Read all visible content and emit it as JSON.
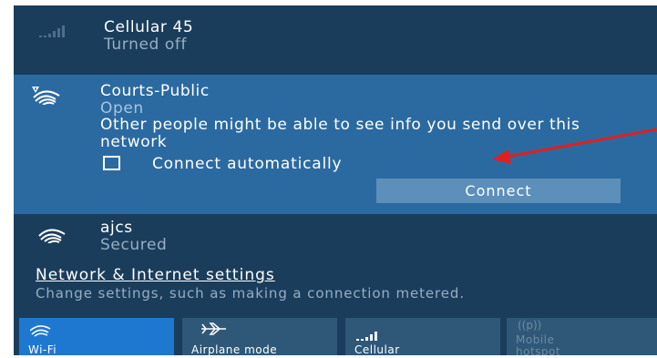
{
  "networks": {
    "cellular": {
      "name": "Cellular 45",
      "status": "Turned off"
    },
    "selected": {
      "name": "Courts-Public",
      "status": "Open",
      "warning": "Other people might be able to see info you send over this network",
      "auto_label": "Connect automatically",
      "auto_checked": false,
      "connect_label": "Connect"
    },
    "ajcs": {
      "name": "ajcs",
      "status": "Secured"
    }
  },
  "settings": {
    "link": "Network & Internet settings",
    "description": "Change settings, such as making a connection metered."
  },
  "tiles": [
    {
      "label": "Wi-Fi",
      "icon": "wifi-icon",
      "active": true
    },
    {
      "label": "Airplane mode",
      "icon": "airplane-icon",
      "active": false
    },
    {
      "label": "Cellular",
      "icon": "cellular-icon",
      "active": false
    },
    {
      "label": "Mobile hotspot",
      "icon": "hotspot-icon",
      "active": false,
      "disabled": true
    }
  ],
  "colors": {
    "panel": "#1a3d5c",
    "selected": "#2b6aa1",
    "accent": "#1f78cf",
    "arrow": "#e02020"
  }
}
